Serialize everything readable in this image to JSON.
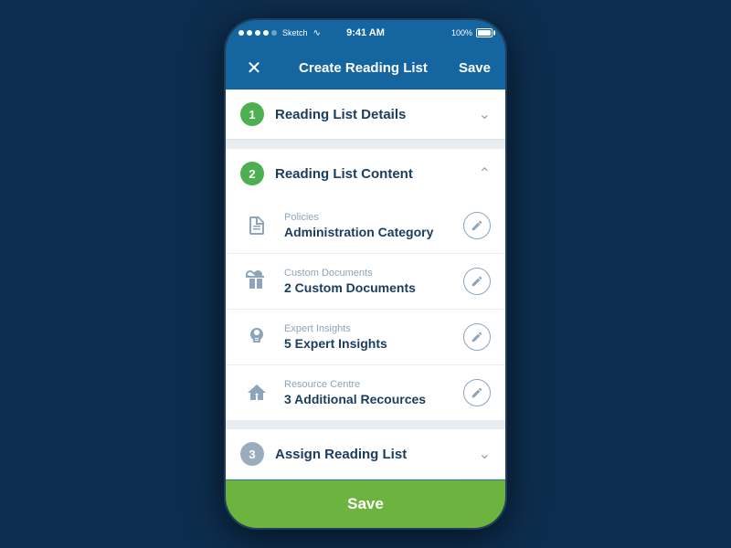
{
  "statusBar": {
    "dots": [
      "●",
      "●",
      "●",
      "●",
      "●"
    ],
    "sketch": "Sketch",
    "wifi": "⊙",
    "time": "9:41 AM",
    "percent": "100%"
  },
  "navBar": {
    "close": "✕",
    "title": "Create Reading List",
    "save": "Save"
  },
  "steps": [
    {
      "id": "step1",
      "number": "1",
      "label": "Reading List Details",
      "expanded": false,
      "chevron": "∨",
      "badgeType": "green"
    },
    {
      "id": "step2",
      "number": "2",
      "label": "Reading List Content",
      "expanded": true,
      "chevron": "∧",
      "badgeType": "green"
    }
  ],
  "contentItems": [
    {
      "label": "Policies",
      "value": "Administration Category",
      "iconType": "document"
    },
    {
      "label": "Custom Documents",
      "value": "2 Custom Documents",
      "iconType": "custom-doc"
    },
    {
      "label": "Expert Insights",
      "value": "5 Expert Insights",
      "iconType": "expert"
    },
    {
      "label": "Resource Centre",
      "value": "3 Additional Recources",
      "iconType": "resource"
    }
  ],
  "step3": {
    "number": "3",
    "label": "Assign Reading List",
    "chevron": "∨",
    "badgeType": "gray"
  },
  "saveButton": {
    "label": "Save"
  }
}
